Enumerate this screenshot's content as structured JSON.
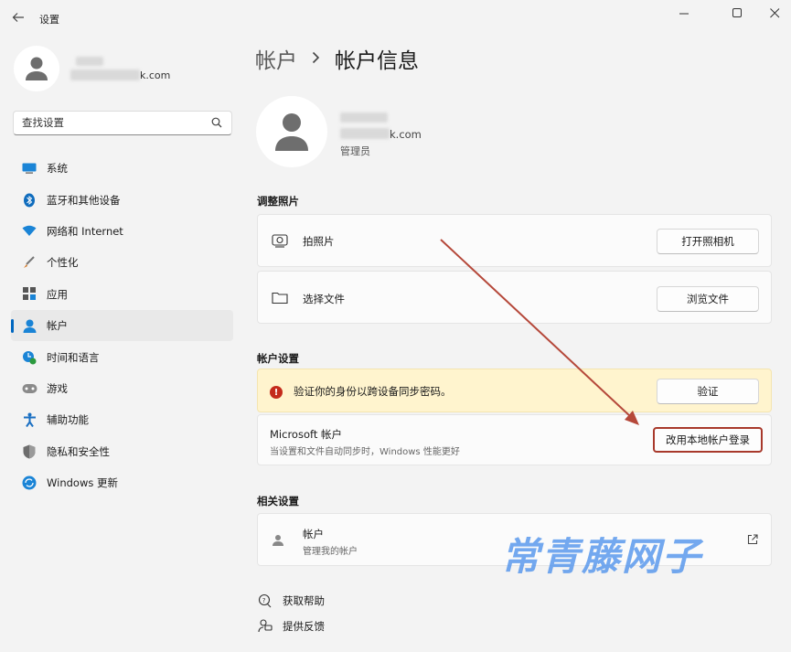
{
  "window": {
    "title": "设置"
  },
  "user": {
    "email_suffix": "k.com",
    "role": "管理员"
  },
  "search": {
    "placeholder": "查找设置"
  },
  "sidebar": {
    "items": [
      {
        "label": "系统",
        "icon": "system-icon"
      },
      {
        "label": "蓝牙和其他设备",
        "icon": "bluetooth-icon"
      },
      {
        "label": "网络和 Internet",
        "icon": "network-icon"
      },
      {
        "label": "个性化",
        "icon": "personalization-icon"
      },
      {
        "label": "应用",
        "icon": "apps-icon"
      },
      {
        "label": "帐户",
        "icon": "accounts-icon",
        "active": true
      },
      {
        "label": "时间和语言",
        "icon": "time-language-icon"
      },
      {
        "label": "游戏",
        "icon": "gaming-icon"
      },
      {
        "label": "辅助功能",
        "icon": "accessibility-icon"
      },
      {
        "label": "隐私和安全性",
        "icon": "privacy-shield-icon"
      },
      {
        "label": "Windows 更新",
        "icon": "windows-update-icon"
      }
    ]
  },
  "breadcrumb": {
    "parent": "帐户",
    "current": "帐户信息"
  },
  "photo": {
    "section_title": "调整照片",
    "take_photo": {
      "label": "拍照片",
      "button": "打开照相机"
    },
    "choose_file": {
      "label": "选择文件",
      "button": "浏览文件"
    }
  },
  "account_settings": {
    "section_title": "帐户设置",
    "warning": {
      "text": "验证你的身份以跨设备同步密码。",
      "button": "验证"
    },
    "microsoft": {
      "title": "Microsoft 帐户",
      "subtitle": "当设置和文件自动同步时，Windows 性能更好",
      "button": "改用本地帐户登录"
    }
  },
  "related": {
    "section_title": "相关设置",
    "accounts": {
      "title": "帐户",
      "subtitle": "管理我的帐户"
    }
  },
  "footer": {
    "help": "获取帮助",
    "feedback": "提供反馈"
  },
  "watermark": "常青藤网子",
  "colors": {
    "accent": "#0067c0",
    "warning_bg": "#fff4ce",
    "warning_icon": "#c42b1c",
    "highlight_border": "#a8392b"
  }
}
